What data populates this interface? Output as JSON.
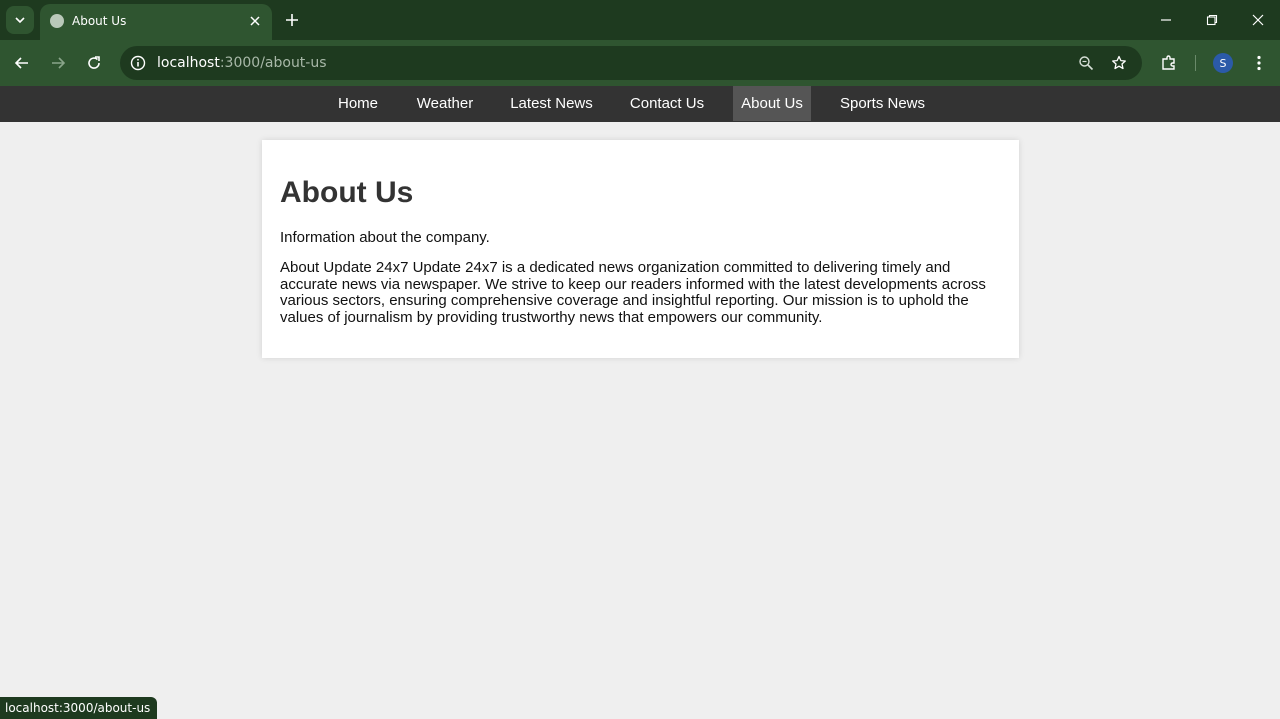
{
  "browser": {
    "tab_title": "About Us",
    "url_host": "localhost",
    "url_path": ":3000/about-us",
    "profile_initial": "S",
    "status_url": "localhost:3000/about-us"
  },
  "nav": {
    "items": [
      "Home",
      "Weather",
      "Latest News",
      "Contact Us",
      "About Us",
      "Sports News"
    ],
    "active": "About Us"
  },
  "content": {
    "heading": "About Us",
    "intro": "Information about the company.",
    "body": "About Update 24x7 Update 24x7 is a dedicated news organization committed to delivering timely and accurate news via newspaper. We strive to keep our readers informed with the latest developments across various sectors, ensuring comprehensive coverage and insightful reporting. Our mission is to uphold the values of journalism by providing trustworthy news that empowers our community."
  },
  "colors": {
    "chrome_dark": "#1e3a1f",
    "chrome": "#2f5530",
    "nav_bg": "#333333",
    "nav_active": "#555555",
    "page_bg": "#efefef"
  }
}
